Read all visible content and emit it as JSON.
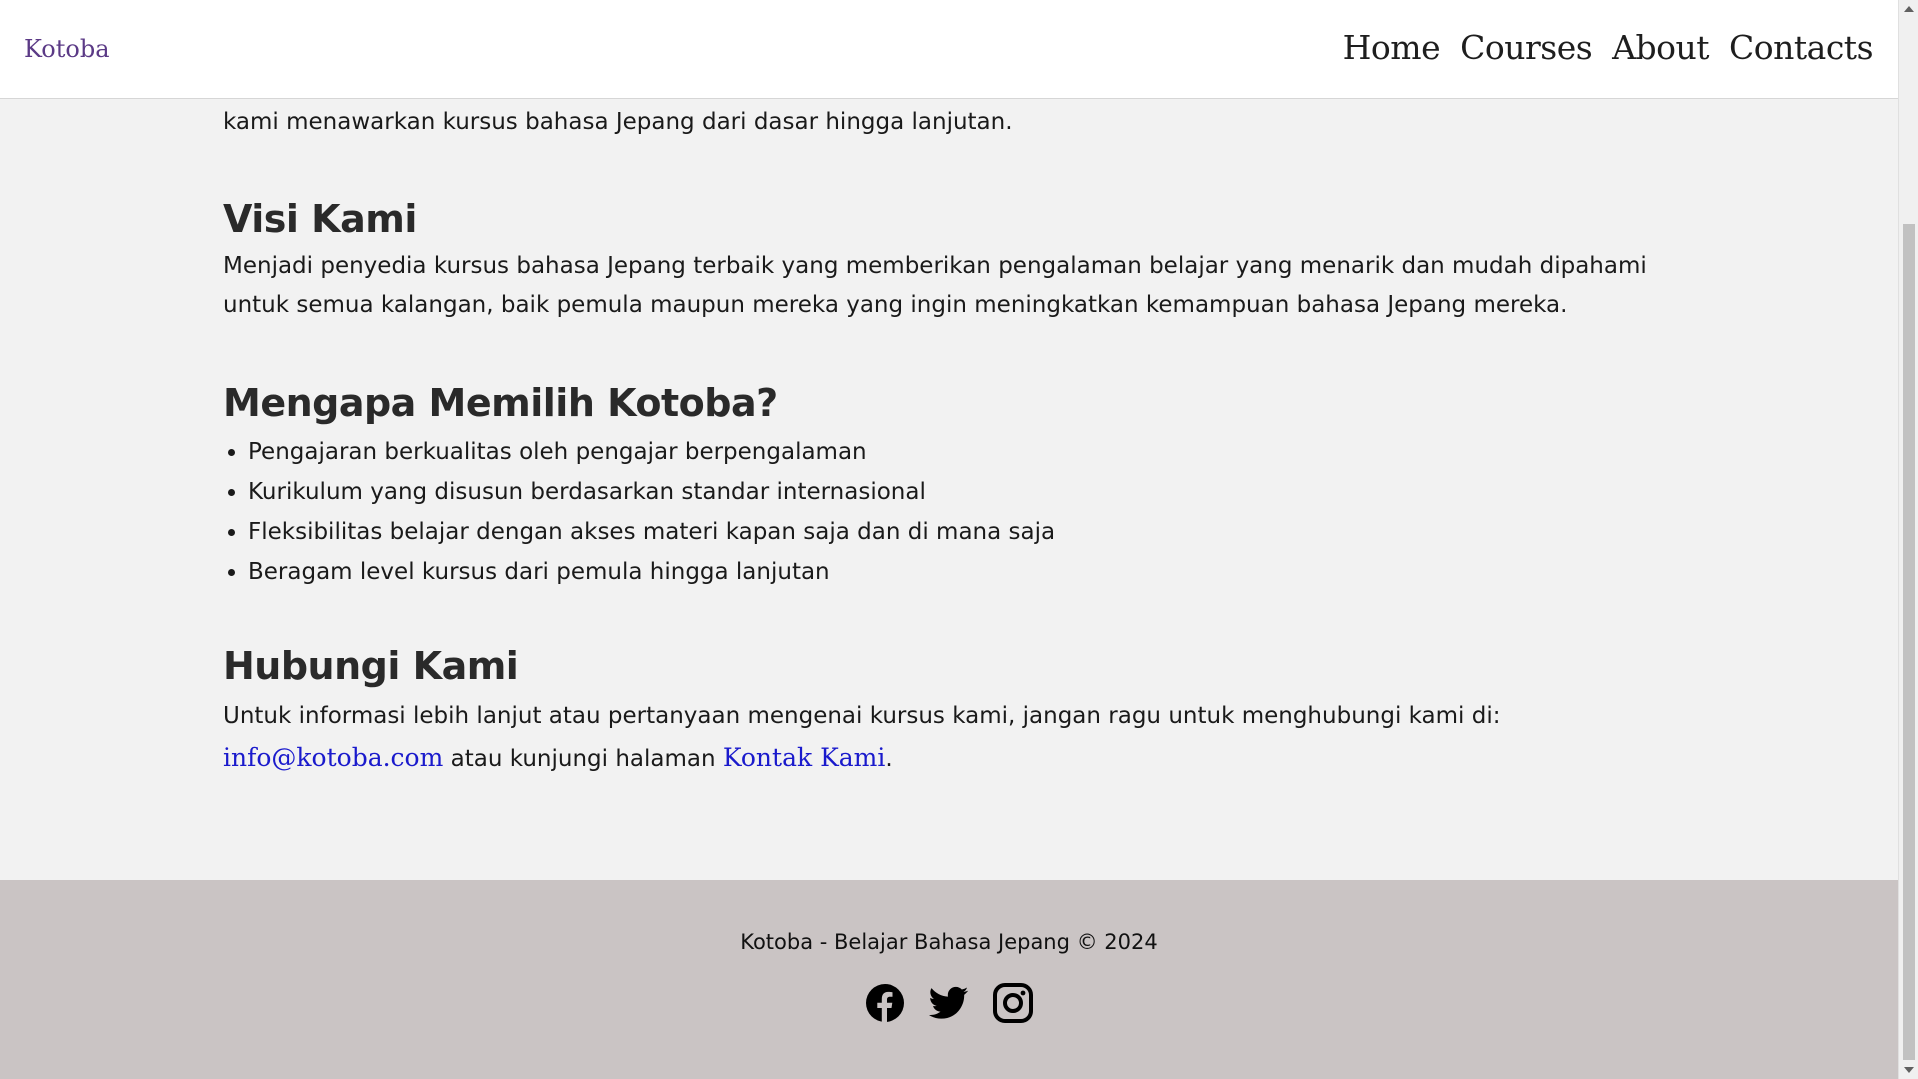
{
  "header": {
    "brand": "Kotoba",
    "nav": [
      "Home",
      "Courses",
      "About",
      "Contacts"
    ]
  },
  "main": {
    "intro": "kami menawarkan kursus bahasa Jepang dari dasar hingga lanjutan.",
    "visi": {
      "title": "Visi Kami",
      "text": "Menjadi penyedia kursus bahasa Jepang terbaik yang memberikan pengalaman belajar yang menarik dan mudah dipahami untuk semua kalangan, baik pemula maupun mereka yang ingin meningkatkan kemampuan bahasa Jepang mereka."
    },
    "why": {
      "title": "Mengapa Memilih Kotoba?",
      "items": [
        "Pengajaran berkualitas oleh pengajar berpengalaman",
        "Kurikulum yang disusun berdasarkan standar internasional",
        "Fleksibilitas belajar dengan akses materi kapan saja dan di mana saja",
        "Beragam level kursus dari pemula hingga lanjutan"
      ]
    },
    "contact": {
      "title": "Hubungi Kami",
      "text_before": "Untuk informasi lebih lanjut atau pertanyaan mengenai kursus kami, jangan ragu untuk menghubungi kami di: ",
      "email": "info@kotoba.com",
      "text_middle": " atau kunjungi halaman ",
      "page_link": "Kontak Kami",
      "text_after": "."
    }
  },
  "footer": {
    "text": "Kotoba - Belajar Bahasa Jepang © 2024",
    "socials": [
      "facebook-icon",
      "twitter-icon",
      "instagram-icon"
    ]
  },
  "colors": {
    "brand": "#5b3a86",
    "link": "#1a1acc",
    "footer_bg": "#cac4c4",
    "page_bg": "#f2f2f2"
  }
}
